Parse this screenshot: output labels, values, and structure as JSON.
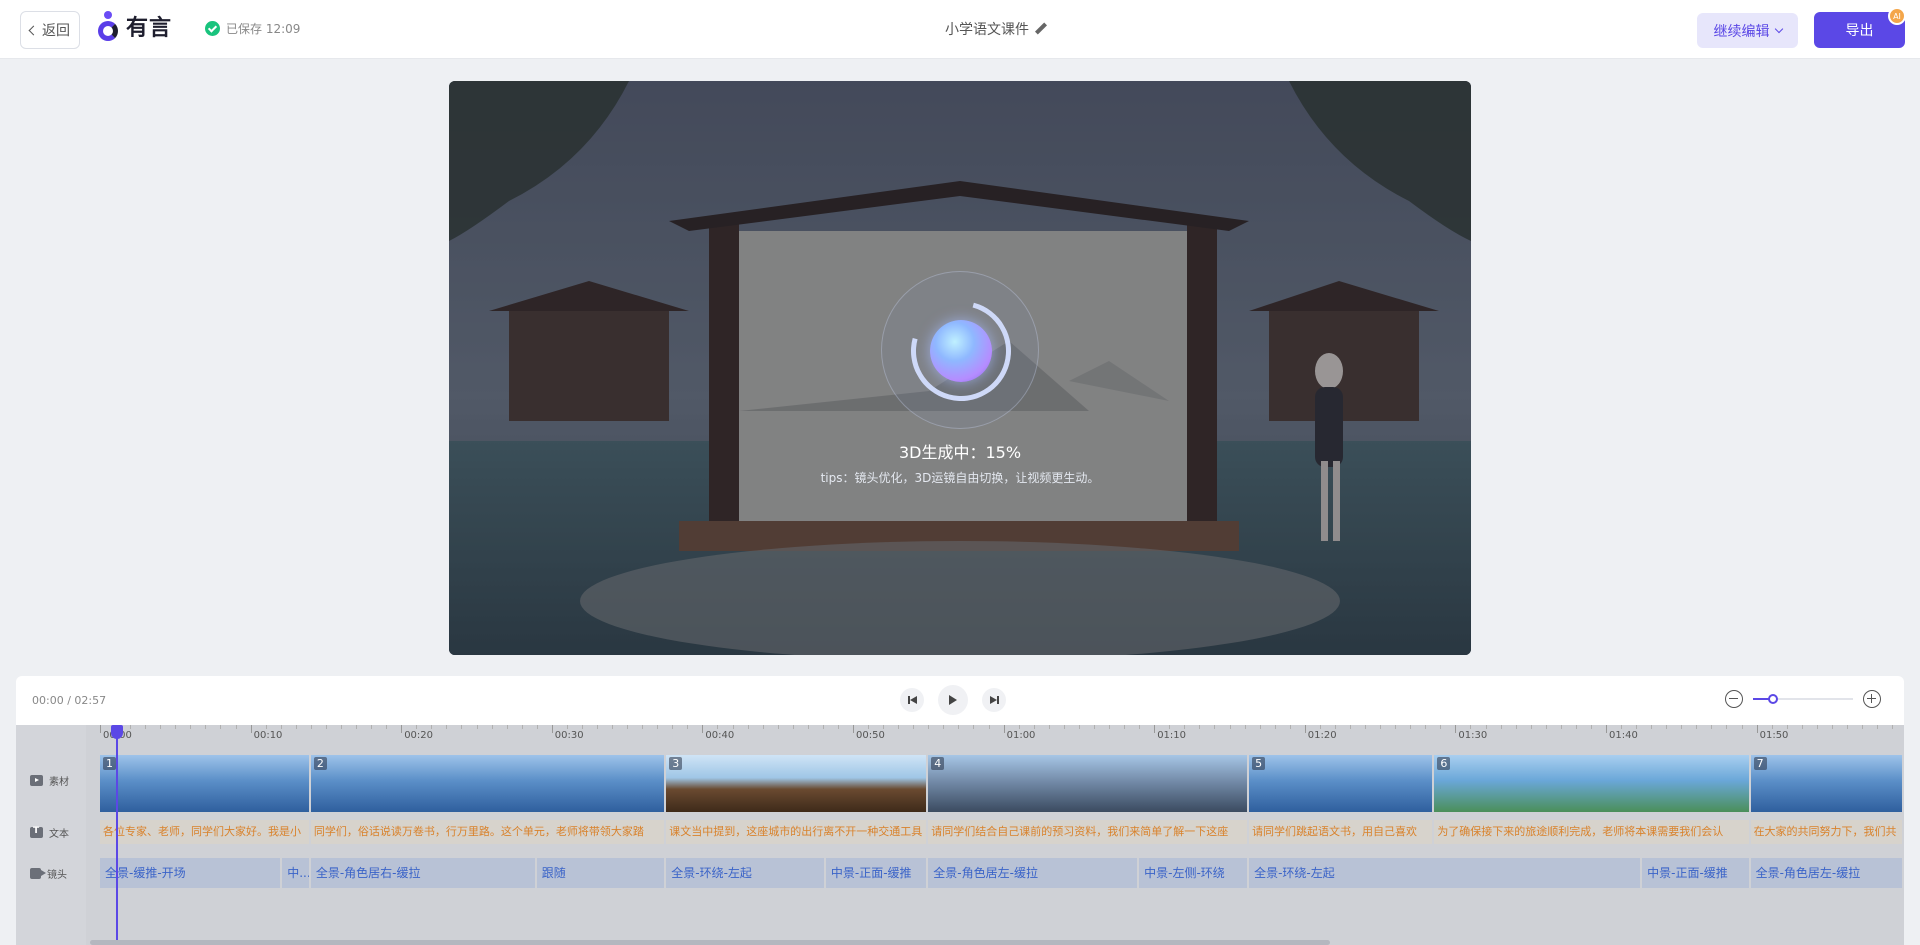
{
  "header": {
    "back_label": "返回",
    "logo_text": "有言",
    "save_status": "已保存 12:09",
    "doc_title": "小学语文课件",
    "continue_label": "继续编辑",
    "export_label": "导出",
    "ai_badge": "AI"
  },
  "preview": {
    "progress_text": "3D生成中：15%",
    "progress_percent": 15,
    "tips": "tips：镜头优化，3D运镜自由切换，让视频更生动。"
  },
  "timeline": {
    "time_readout": "00:00 / 02:57",
    "zoom_level_fraction": 0.2,
    "track_labels": [
      "素材",
      "文本",
      "镜头"
    ],
    "ruler_labels": [
      "00:00",
      "00:10",
      "00:20",
      "00:30",
      "00:40",
      "00:50",
      "01:00",
      "01:10",
      "01:20",
      "01:30",
      "01:40",
      "01:50"
    ],
    "material_clips": [
      {
        "num": "1",
        "start": 0,
        "end": 14,
        "style": "blue"
      },
      {
        "num": "2",
        "start": 14,
        "end": 37.6,
        "style": "blue"
      },
      {
        "num": "3",
        "start": 37.6,
        "end": 55,
        "style": "boat"
      },
      {
        "num": "4",
        "start": 55,
        "end": 76.3,
        "style": "dark"
      },
      {
        "num": "5",
        "start": 76.3,
        "end": 88.6,
        "style": "blue"
      },
      {
        "num": "6",
        "start": 88.6,
        "end": 109.6,
        "style": "green"
      },
      {
        "num": "7",
        "start": 109.6,
        "end": 120,
        "style": "blue"
      }
    ],
    "text_clips": [
      {
        "text": "各位专家、老师，同学们大家好。我是小",
        "start": 0,
        "end": 14
      },
      {
        "text": "同学们，俗话说读万卷书，行万里路。这个单元，老师将带领大家踏",
        "start": 14,
        "end": 37.6
      },
      {
        "text": "课文当中提到，这座城市的出行离不开一种交通工具",
        "start": 37.6,
        "end": 55
      },
      {
        "text": "请同学们结合自己课前的预习资料，我们来简单了解一下这座",
        "start": 55,
        "end": 76.3
      },
      {
        "text": "请同学们跳起语文书，用自己喜欢",
        "start": 76.3,
        "end": 88.6
      },
      {
        "text": "为了确保接下来的旅途顺利完成，老师将本课需要我们会认",
        "start": 88.6,
        "end": 109.6
      },
      {
        "text": "在大家的共同努力下，我们共",
        "start": 109.6,
        "end": 120
      }
    ],
    "shot_clips": [
      {
        "text": "全景-缓推-开场",
        "start": 0,
        "end": 12.1
      },
      {
        "text": "中...",
        "start": 12.1,
        "end": 14
      },
      {
        "text": "全景-角色居右-缓拉",
        "start": 14,
        "end": 29
      },
      {
        "text": "跟随",
        "start": 29,
        "end": 37.6
      },
      {
        "text": "全景-环绕-左起",
        "start": 37.6,
        "end": 48.2
      },
      {
        "text": "中景-正面-缓推",
        "start": 48.2,
        "end": 55
      },
      {
        "text": "全景-角色居左-缓拉",
        "start": 55,
        "end": 69
      },
      {
        "text": "中景-左侧-环绕",
        "start": 69,
        "end": 76.3
      },
      {
        "text": "全景-环绕-左起",
        "start": 76.3,
        "end": 102.4
      },
      {
        "text": "中景-正面-缓推",
        "start": 102.4,
        "end": 109.6
      },
      {
        "text": "全景-角色居左-缓拉",
        "start": 109.6,
        "end": 120
      }
    ]
  }
}
